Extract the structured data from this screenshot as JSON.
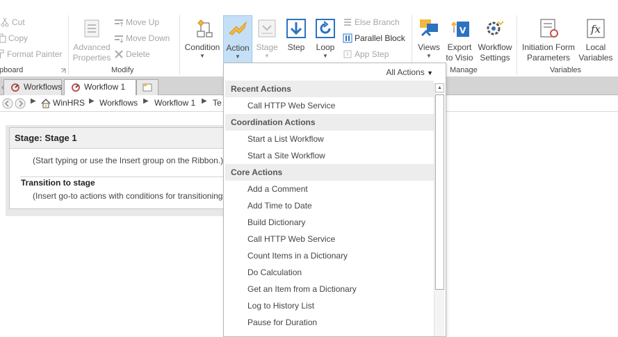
{
  "ribbon": {
    "clipboard": {
      "cut": "Cut",
      "copy": "Copy",
      "format_painter": "Format Painter",
      "label": "pboard"
    },
    "modify": {
      "advanced_properties": "Advanced Properties",
      "move_up": "Move Up",
      "move_down": "Move Down",
      "delete": "Delete",
      "label": "Modify"
    },
    "insert": {
      "condition": "Condition",
      "action": "Action",
      "stage": "Stage",
      "step": "Step",
      "loop": "Loop",
      "else_branch": "Else Branch",
      "parallel_block": "Parallel Block",
      "app_step": "App Step"
    },
    "manage": {
      "views": "Views",
      "export_to_visio": "Export to Visio",
      "workflow_settings": "Workflow Settings",
      "label": "Manage"
    },
    "variables": {
      "initiation_form_parameters": "Initiation Form Parameters",
      "local_variables": "Local Variables",
      "label": "Variables"
    }
  },
  "tabs": [
    "Workflows",
    "Workflow 1 *"
  ],
  "breadcrumb": [
    "WinHRS",
    "Workflows",
    "Workflow 1",
    "Te"
  ],
  "stage": {
    "title": "Stage: Stage 1",
    "hint": "(Start typing or use the Insert group on the Ribbon.)",
    "transition_title": "Transition to stage",
    "transition_hint": "(Insert go-to actions with conditions for transitioning"
  },
  "dropdown": {
    "filter": "All Actions",
    "sections": [
      {
        "header": "Recent Actions",
        "items": [
          "Call HTTP Web Service"
        ]
      },
      {
        "header": "Coordination Actions",
        "items": [
          "Start a List Workflow",
          "Start a Site Workflow"
        ]
      },
      {
        "header": "Core Actions",
        "items": [
          "Add a Comment",
          "Add Time to Date",
          "Build Dictionary",
          "Call HTTP Web Service",
          "Count Items in a Dictionary",
          "Do Calculation",
          "Get an Item from a Dictionary",
          "Log to History List",
          "Pause for Duration"
        ]
      }
    ]
  },
  "colors": {
    "accent_blue": "#2b73c0",
    "active_button_bg": "#c5e0f6",
    "action_orange": "#f4b840"
  }
}
